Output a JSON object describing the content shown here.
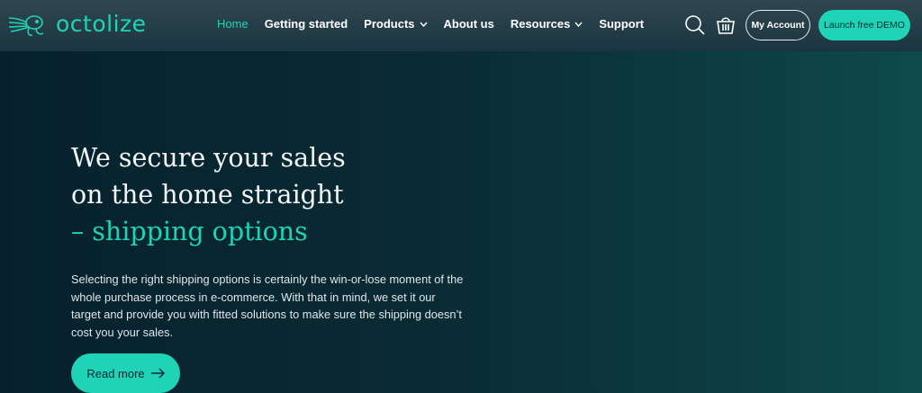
{
  "brand": {
    "name": "octolize",
    "logo_icon": "octopus-logo-icon"
  },
  "nav": {
    "items": [
      {
        "label": "Home",
        "active": true
      },
      {
        "label": "Getting started"
      },
      {
        "label": "Products",
        "dropdown": true
      },
      {
        "label": "About us"
      },
      {
        "label": "Resources",
        "dropdown": true
      },
      {
        "label": "Support"
      }
    ]
  },
  "header_actions": {
    "search_icon": "search-icon",
    "cart_icon": "shopping-basket-icon",
    "account_label": "My Account",
    "demo_label": "Launch free DEMO"
  },
  "hero": {
    "title_line1": "We secure your sales",
    "title_line2": "on the home straight",
    "title_accent": "– shipping options",
    "body": "Selecting the right shipping options is certainly the win-or-lose moment of the whole purchase process in e-commerce. With that in mind, we set it our target and provide you with fitted solutions to make sure the shipping doesn’t cost you your sales.",
    "cta_label": "Read more",
    "cta_icon": "arrow-right-icon"
  },
  "colors": {
    "accent": "#1fd3b6",
    "background_dark": "#06212d",
    "background_teal": "#0e4a4c"
  }
}
